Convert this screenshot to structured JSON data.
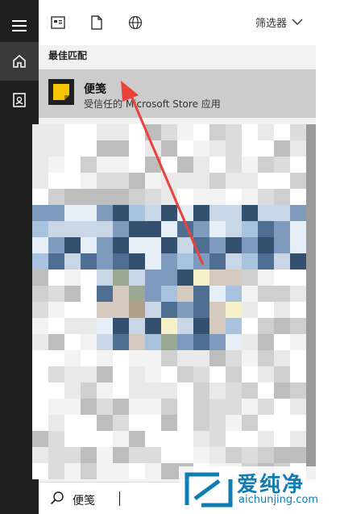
{
  "rail": {
    "icons": [
      "hamburger-menu-icon",
      "home-icon",
      "document-icon"
    ]
  },
  "toolbar": {
    "icons": [
      "app-list-icon",
      "documents-icon",
      "web-icon"
    ],
    "filter_label": "筛选器"
  },
  "results": {
    "section_title": "最佳匹配",
    "best_match": {
      "name": "便笺",
      "subtitle": "受信任的 Microsoft Store 应用"
    }
  },
  "search": {
    "value": "便笺"
  },
  "watermark": {
    "brand_cn": "爱纯净",
    "brand_en": "aichunjing.com"
  },
  "colors": {
    "rail_bg": "#1f1f1f",
    "highlight_bg": "#cccccc",
    "arrow": "#e8423a",
    "watermark": "#0f7db3",
    "sticky_notes_yellow": "#f7c400"
  }
}
